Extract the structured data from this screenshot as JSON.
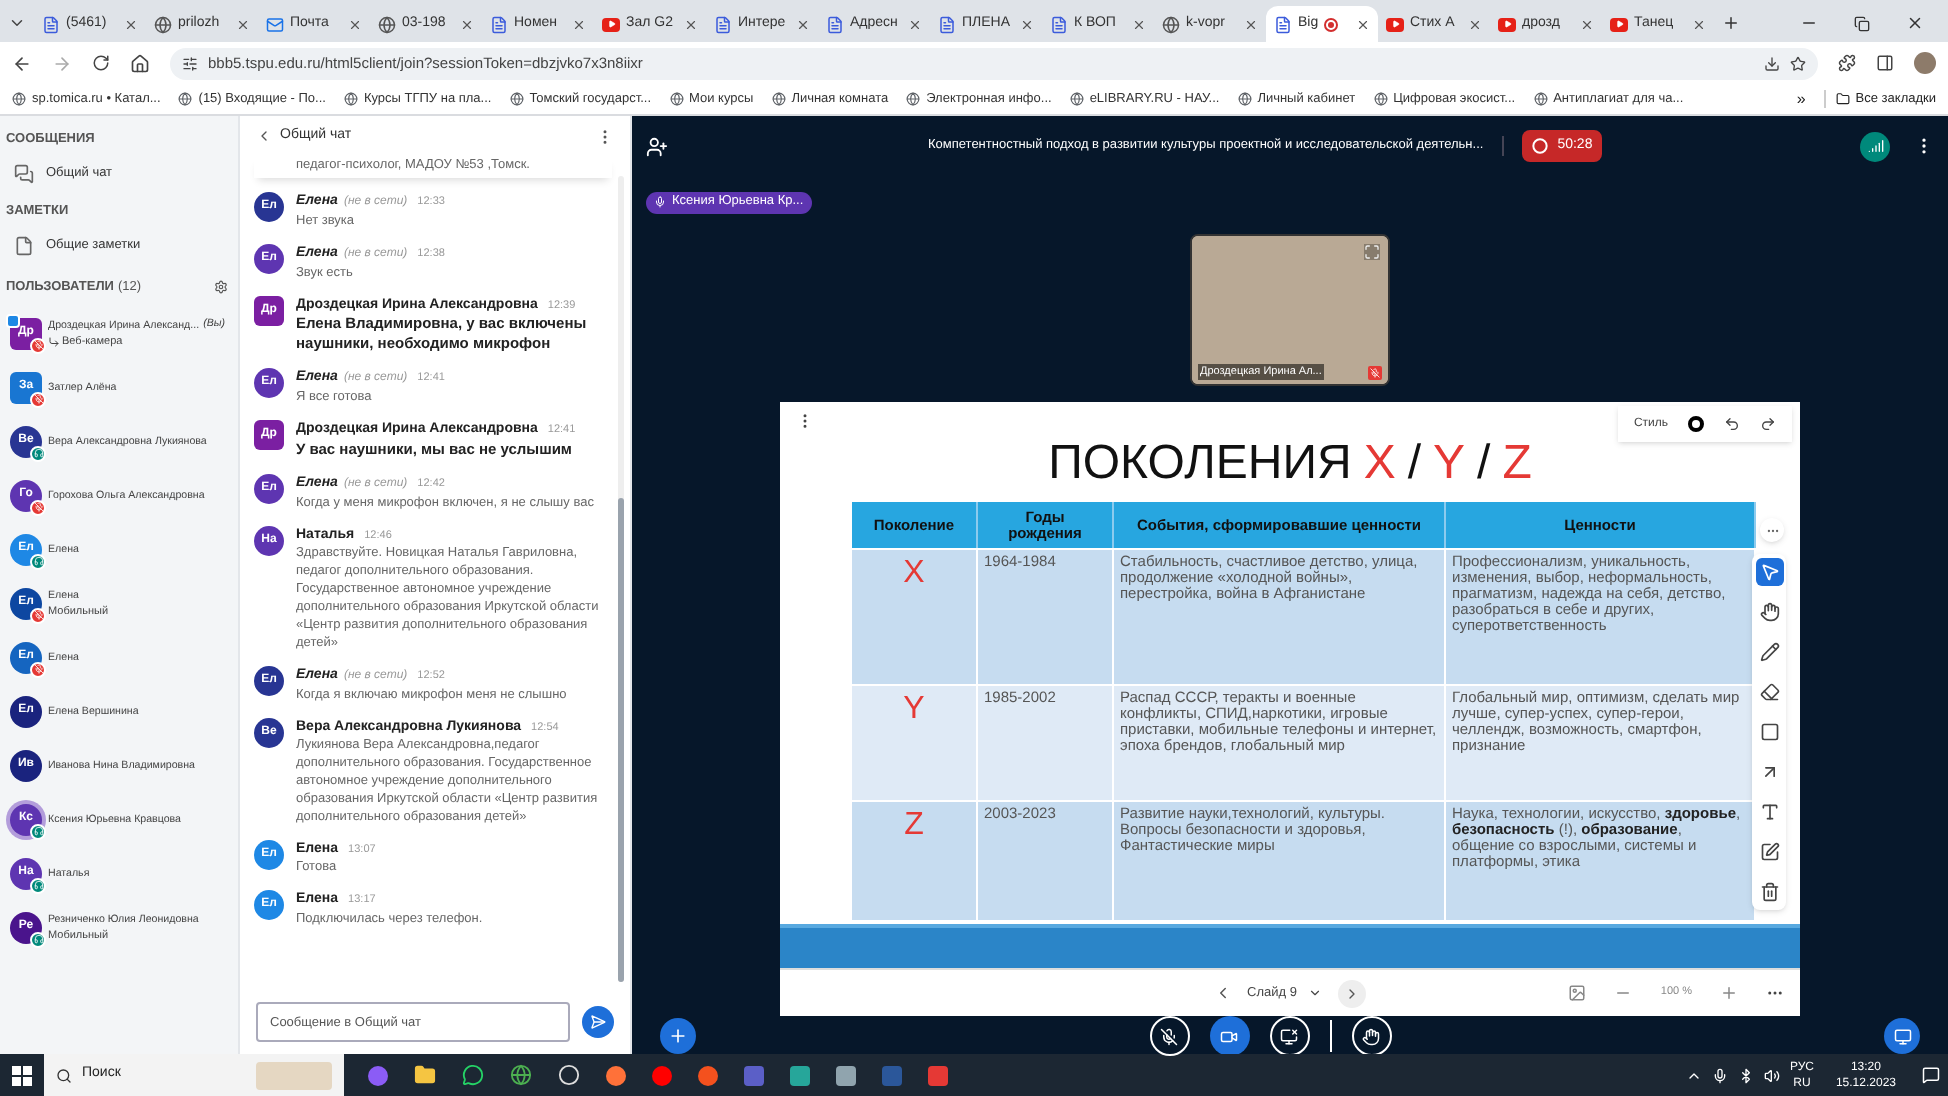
{
  "browser": {
    "tabs": [
      {
        "title": "(5461)",
        "kind": "page",
        "selected": false,
        "recording": false
      },
      {
        "title": "prilozh",
        "kind": "globe",
        "selected": false,
        "recording": false
      },
      {
        "title": "Почта",
        "kind": "mail",
        "selected": false,
        "recording": false
      },
      {
        "title": "03-198",
        "kind": "globe",
        "selected": false,
        "recording": false
      },
      {
        "title": "Номен",
        "kind": "page",
        "selected": false,
        "recording": false
      },
      {
        "title": "Зал G2",
        "kind": "video",
        "selected": false,
        "recording": false
      },
      {
        "title": "Интере",
        "kind": "page",
        "selected": false,
        "recording": false
      },
      {
        "title": "Адресн",
        "kind": "page",
        "selected": false,
        "recording": false
      },
      {
        "title": "ПЛЕНА",
        "kind": "page",
        "selected": false,
        "recording": false
      },
      {
        "title": "К ВОП",
        "kind": "page",
        "selected": false,
        "recording": false
      },
      {
        "title": "k-vopr",
        "kind": "globe",
        "selected": false,
        "recording": false
      },
      {
        "title": "Big",
        "kind": "page",
        "selected": true,
        "recording": true
      },
      {
        "title": "Стих А",
        "kind": "video",
        "selected": false,
        "recording": false
      },
      {
        "title": "дрозд",
        "kind": "video",
        "selected": false,
        "recording": false
      },
      {
        "title": "Танец",
        "kind": "video",
        "selected": false,
        "recording": false
      }
    ],
    "address": "bbb5.tspu.edu.ru/html5client/join?sessionToken=dbzjvko7x3n8iixr",
    "bookmarks": [
      "sp.tomica.ru • Катал...",
      "(15) Входящие - По...",
      "Курсы ТГПУ на пла...",
      "Томский государст...",
      "Мои курсы",
      "Личная комната",
      "Электронная инфо...",
      "eLIBRARY.RU - НАУ...",
      "Личный кабинет",
      "Цифровая экосист...",
      "Антиплагиат для ча..."
    ],
    "more_bookmarks": "»",
    "all_bookmarks": "Все закладки"
  },
  "sidebar": {
    "messages_heading": "СООБЩЕНИЯ",
    "public_chat": "Общий чат",
    "notes_heading": "ЗАМЕТКИ",
    "shared_notes": "Общие заметки",
    "users_heading": "ПОЛЬЗОВАТЕЛИ",
    "users_count": "(12)",
    "users": [
      {
        "initials": "Др",
        "name": "Дроздецкая Ирина Александ...",
        "you_label": "(Вы)",
        "detail": "Веб-камера",
        "webcam_detail": true,
        "square_avatar": true,
        "color": "#7b1fa2",
        "mic_muted": true,
        "listen_only": false,
        "presenter": true,
        "talking": false
      },
      {
        "initials": "За",
        "name": "Затлер Алёна",
        "square_avatar": true,
        "color": "#1976d2",
        "mic_muted": true,
        "listen_only": false,
        "presenter": false,
        "talking": false
      },
      {
        "initials": "Ве",
        "name": "Вера Александровна Лукиянова",
        "square_avatar": false,
        "color": "#283593",
        "mic_muted": false,
        "listen_only": true,
        "presenter": false,
        "talking": false
      },
      {
        "initials": "Го",
        "name": "Горохова Ольга Александровна",
        "square_avatar": false,
        "color": "#5e35b1",
        "mic_muted": true,
        "listen_only": false,
        "presenter": false,
        "talking": false
      },
      {
        "initials": "Ел",
        "name": "Елена",
        "square_avatar": false,
        "color": "#1e88e5",
        "mic_muted": false,
        "listen_only": true,
        "presenter": false,
        "talking": false
      },
      {
        "initials": "Ел",
        "name": "Елена",
        "detail": "Мобильный",
        "webcam_detail": false,
        "square_avatar": false,
        "color": "#0d47a1",
        "mic_muted": true,
        "listen_only": false,
        "presenter": false,
        "talking": false
      },
      {
        "initials": "Ел",
        "name": "Елена",
        "square_avatar": false,
        "color": "#1565c0",
        "mic_muted": true,
        "listen_only": false,
        "presenter": false,
        "talking": false
      },
      {
        "initials": "Ел",
        "name": "Елена Вершинина",
        "square_avatar": false,
        "color": "#1a237e",
        "mic_muted": false,
        "listen_only": false,
        "presenter": false,
        "talking": false
      },
      {
        "initials": "Ив",
        "name": "Иванова Нина Владимировна",
        "square_avatar": false,
        "color": "#1a237e",
        "mic_muted": false,
        "listen_only": false,
        "presenter": false,
        "talking": false
      },
      {
        "initials": "Кс",
        "name": "Ксения Юрьевна Кравцова",
        "square_avatar": false,
        "color": "#5e35b1",
        "mic_muted": false,
        "listen_only": true,
        "presenter": false,
        "talking": true
      },
      {
        "initials": "На",
        "name": "Наталья",
        "square_avatar": false,
        "color": "#5e35b1",
        "mic_muted": false,
        "listen_only": true,
        "presenter": false,
        "talking": false
      },
      {
        "initials": "Ре",
        "name": "Резниченко Юлия Леонидовна",
        "detail": "Мобильный",
        "webcam_detail": false,
        "square_avatar": false,
        "color": "#4a148c",
        "mic_muted": false,
        "listen_only": true,
        "presenter": false,
        "talking": false
      }
    ]
  },
  "chat": {
    "title": "Общий чат",
    "clipped_text": "педагог-психолог, МАДОУ №53 ,Томск.",
    "messages": [
      {
        "initials": "Ел",
        "square_avatar": false,
        "color": "#283593",
        "name": "Елена",
        "status_note": "(не в сети)",
        "time": "12:33",
        "text": "Нет звука",
        "emphasized": false
      },
      {
        "initials": "Ел",
        "square_avatar": false,
        "color": "#5e35b1",
        "name": "Елена",
        "status_note": "(не в сети)",
        "time": "12:38",
        "text": "Звук есть",
        "emphasized": false
      },
      {
        "initials": "Др",
        "square_avatar": true,
        "color": "#7b1fa2",
        "name": "Дроздецкая Ирина Александровна",
        "time": "12:39",
        "text": "Елена Владимировна, у вас включены наушники, необходимо микрофон",
        "emphasized": true
      },
      {
        "initials": "Ел",
        "square_avatar": false,
        "color": "#5e35b1",
        "name": "Елена",
        "status_note": "(не в сети)",
        "time": "12:41",
        "text": "Я все готова",
        "emphasized": false
      },
      {
        "initials": "Др",
        "square_avatar": true,
        "color": "#7b1fa2",
        "name": "Дроздецкая Ирина Александровна",
        "time": "12:41",
        "text": "У вас наушники, мы вас не услышим",
        "emphasized": true
      },
      {
        "initials": "Ел",
        "square_avatar": false,
        "color": "#5e35b1",
        "name": "Елена",
        "status_note": "(не в сети)",
        "time": "12:42",
        "text": "Когда у меня микрофон включен, я не слышу вас",
        "emphasized": false
      },
      {
        "initials": "На",
        "square_avatar": false,
        "color": "#5e35b1",
        "name": "Наталья",
        "time": "12:46",
        "text": "Здравствуйте. Новицкая Наталья Гавриловна, педагог дополнительного образования. Государственное автономное учреждение дополнительного образования Иркутской области «Центр развития дополнительного образования детей»",
        "emphasized": false
      },
      {
        "initials": "Ел",
        "square_avatar": false,
        "color": "#283593",
        "name": "Елена",
        "status_note": "(не в сети)",
        "time": "12:52",
        "text": "Когда я включаю микрофон меня не слышно",
        "emphasized": false
      },
      {
        "initials": "Ве",
        "square_avatar": false,
        "color": "#283593",
        "name": "Вера Александровна Лукиянова",
        "time": "12:54",
        "text": "Лукиянова Вера Александровна,педагог дополнительного образования. Государственное автономное учреждение дополнительного образования Иркутской области «Центр развития дополнительного образования детей»",
        "emphasized": false
      },
      {
        "initials": "Ел",
        "square_avatar": false,
        "color": "#1e88e5",
        "name": "Елена",
        "time": "13:07",
        "text": "Готова",
        "emphasized": false
      },
      {
        "initials": "Ел",
        "square_avatar": false,
        "color": "#1e88e5",
        "name": "Елена",
        "time": "13:17",
        "text": "Подключилась через телефон.",
        "emphasized": false
      }
    ],
    "input": {
      "placeholder": "Сообщение в Общий чат"
    }
  },
  "meeting": {
    "title": "Компетентностный подход в развитии культуры проектной и исследовательской деятельн...",
    "recording": {
      "on": true,
      "time": "50:28"
    },
    "talking": "Ксения Юрьевна Кр...",
    "webcam": {
      "name": "Дроздецкая Ирина Ал...",
      "muted": true
    }
  },
  "slide": {
    "title_parts": [
      {
        "text": "ПОКОЛЕНИЯ",
        "color": "#111111"
      },
      {
        "text": "X",
        "color": "#e53935"
      },
      {
        "text": "/",
        "color": "#111111"
      },
      {
        "text": "Y",
        "color": "#e53935"
      },
      {
        "text": "/",
        "color": "#111111"
      },
      {
        "text": "Z",
        "color": "#e53935"
      }
    ],
    "table": {
      "columns": [
        "Поколение",
        "Годы рождения",
        "События, сформировавшие ценности",
        "Ценности"
      ],
      "rows": [
        [
          "X",
          "1964-1984",
          "Стабильность, счастливое детство, улица, продолжение «холодной войны», перестройка, война в Афганистане",
          "Профессионализм, уникальность, изменения, выбор, неформальность, прагматизм, надежда на себя, детство, разобраться в себе и других, суперответственность"
        ],
        [
          "Y",
          "1985-2002",
          "Распад СССР, теракты и военные конфликты, СПИД,наркотики, игровые приставки, мобильные телефоны и интернет, эпоха брендов, глобальный мир",
          "Глобальный мир, оптимизм, сделать мир лучше, супер-успех, супер-герои, челлендж, возможность, смартфон, признание"
        ],
        [
          "Z",
          "2003-2023",
          "Развитие науки,технологий, культуры. Вопросы безопасности и здоровья, Фантастические миры",
          "Наука, технологии, искусство, **здоровье**, **безопасность** (!), **образование**, общение со взрослыми, системы и платформы, этика"
        ]
      ]
    },
    "style_label": "Стиль",
    "tools": [
      {
        "kind": "select",
        "selected": true
      },
      {
        "kind": "hand",
        "selected": false
      },
      {
        "kind": "pencil",
        "selected": false
      },
      {
        "kind": "eraser",
        "selected": false
      },
      {
        "kind": "rectangle",
        "selected": false
      },
      {
        "kind": "arrow",
        "selected": false
      },
      {
        "kind": "text",
        "selected": false
      },
      {
        "kind": "note",
        "selected": false
      },
      {
        "kind": "delete",
        "selected": false
      }
    ],
    "page_label": "Слайд 9",
    "zoom": "100 %"
  },
  "controls": {
    "mic_muted": true,
    "camera_on": true,
    "screen_sharing": false
  },
  "taskbar": {
    "search": "Поиск",
    "language": "РУС",
    "region": "RU",
    "time": "13:20",
    "date": "15.12.2023"
  }
}
